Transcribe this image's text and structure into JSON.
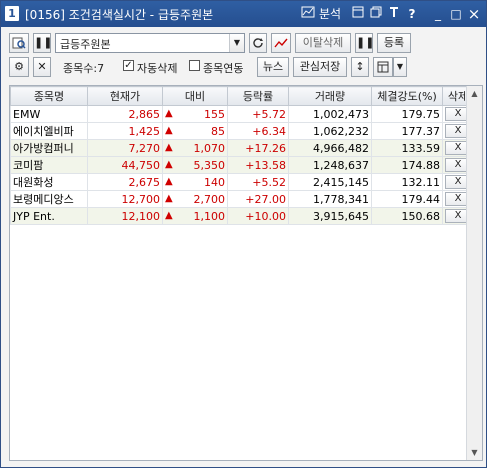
{
  "window": {
    "icon_label": "1",
    "title": "[0156] 조건검색실시간 - 급등주원본",
    "controls": {
      "analysis": "분석",
      "help": "?",
      "minimize": "_",
      "maximize": "□",
      "close": "×"
    }
  },
  "toolbar1": {
    "condition_select": "급등주원본",
    "exit_delete_label": "이탈삭제",
    "register_label": "등록"
  },
  "toolbar2": {
    "count_label": "종목수:7",
    "auto_delete_label": "자동삭제",
    "auto_delete_checked": true,
    "link_label": "종목연동",
    "link_checked": false,
    "news_label": "뉴스",
    "watchlist_save_label": "관심저장"
  },
  "table": {
    "columns": [
      "종목명",
      "현재가",
      "대비",
      "등락률",
      "거래량",
      "체결강도(%)",
      "삭제"
    ],
    "rows": [
      {
        "name": "EMW",
        "price": "2,865",
        "change": "155",
        "rate": "+5.72",
        "volume": "1,002,473",
        "strength": "179.75",
        "del": "X"
      },
      {
        "name": "에이치엘비파",
        "price": "1,425",
        "change": "85",
        "rate": "+6.34",
        "volume": "1,062,232",
        "strength": "177.37",
        "del": "X"
      },
      {
        "name": "아가방컴퍼니",
        "price": "7,270",
        "change": "1,070",
        "rate": "+17.26",
        "volume": "4,966,482",
        "strength": "133.59",
        "del": "X"
      },
      {
        "name": "코미팜",
        "price": "44,750",
        "change": "5,350",
        "rate": "+13.58",
        "volume": "1,248,637",
        "strength": "174.88",
        "del": "X"
      },
      {
        "name": "대원화성",
        "price": "2,675",
        "change": "140",
        "rate": "+5.52",
        "volume": "2,415,145",
        "strength": "132.11",
        "del": "X"
      },
      {
        "name": "보령메디앙스",
        "price": "12,700",
        "change": "2,700",
        "rate": "+27.00",
        "volume": "1,778,341",
        "strength": "179.44",
        "del": "X"
      },
      {
        "name": "JYP Ent.",
        "price": "12,100",
        "change": "1,100",
        "rate": "+10.00",
        "volume": "3,915,645",
        "strength": "150.68",
        "del": "X"
      }
    ]
  },
  "colors": {
    "up": "#cc0000",
    "title_bar": "#2a5597",
    "row_highlight": "#f2f5ea"
  }
}
